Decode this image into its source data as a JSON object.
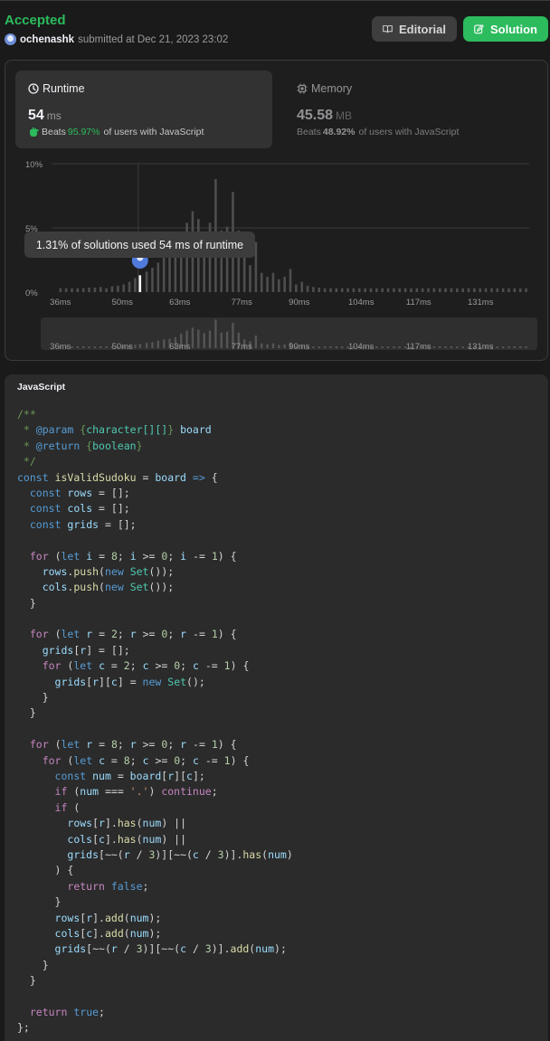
{
  "header": {
    "status": "Accepted",
    "username": "ochenashk",
    "submitted_text": "submitted at Dec 21, 2023 23:02",
    "editorial_label": "Editorial",
    "solution_label": "Solution"
  },
  "runtime": {
    "title": "Runtime",
    "value": "54",
    "unit": "ms",
    "beats_prefix": "Beats",
    "beats_pct": "95.97%",
    "beats_suffix": "of users with JavaScript"
  },
  "memory": {
    "title": "Memory",
    "value": "45.58",
    "unit": "MB",
    "beats_prefix": "Beats",
    "beats_pct": "48.92%",
    "beats_suffix": "of users with JavaScript"
  },
  "tooltip": "1.31% of solutions used 54 ms of runtime",
  "chart_data": {
    "type": "bar",
    "y_ticks": [
      "10%",
      "5%",
      "0%"
    ],
    "ylim": [
      0,
      10
    ],
    "x_ticks": [
      "36ms",
      "50ms",
      "63ms",
      "77ms",
      "90ms",
      "104ms",
      "117ms",
      "131ms"
    ],
    "x_tick_values": [
      36,
      50,
      63,
      77,
      90,
      104,
      117,
      131
    ],
    "xlim": [
      34,
      142
    ],
    "highlight_x": 54,
    "highlight_value": 1.31,
    "bars": [
      {
        "x": 36,
        "v": 0.3
      },
      {
        "x": 37.3,
        "v": 0.3
      },
      {
        "x": 38.6,
        "v": 0.3
      },
      {
        "x": 39.9,
        "v": 0.3
      },
      {
        "x": 41.2,
        "v": 0.3
      },
      {
        "x": 42.5,
        "v": 0.35
      },
      {
        "x": 43.8,
        "v": 0.35
      },
      {
        "x": 45.1,
        "v": 0.4
      },
      {
        "x": 46.4,
        "v": 0.3
      },
      {
        "x": 47.7,
        "v": 0.45
      },
      {
        "x": 49,
        "v": 0.5
      },
      {
        "x": 50.3,
        "v": 0.6
      },
      {
        "x": 51.6,
        "v": 0.8
      },
      {
        "x": 52.9,
        "v": 1.1
      },
      {
        "x": 54,
        "v": 1.31
      },
      {
        "x": 55.5,
        "v": 1.6
      },
      {
        "x": 56.8,
        "v": 1.9
      },
      {
        "x": 58.1,
        "v": 2.3
      },
      {
        "x": 59.4,
        "v": 2.7
      },
      {
        "x": 60.7,
        "v": 2.9
      },
      {
        "x": 62,
        "v": 3.4
      },
      {
        "x": 63.3,
        "v": 4.5
      },
      {
        "x": 64.6,
        "v": 5.4
      },
      {
        "x": 65.9,
        "v": 6.3
      },
      {
        "x": 67.2,
        "v": 5.7
      },
      {
        "x": 68.5,
        "v": 4.6
      },
      {
        "x": 69.8,
        "v": 5.4
      },
      {
        "x": 71.1,
        "v": 8.8
      },
      {
        "x": 72.4,
        "v": 4.8
      },
      {
        "x": 73.7,
        "v": 5.1
      },
      {
        "x": 75,
        "v": 7.8
      },
      {
        "x": 76.3,
        "v": 4.8
      },
      {
        "x": 77.6,
        "v": 2.7
      },
      {
        "x": 78.9,
        "v": 2.1
      },
      {
        "x": 80.2,
        "v": 3.9
      },
      {
        "x": 81.5,
        "v": 1.5
      },
      {
        "x": 82.8,
        "v": 1.2
      },
      {
        "x": 84.1,
        "v": 1.5
      },
      {
        "x": 85.4,
        "v": 1.0
      },
      {
        "x": 86.7,
        "v": 1.2
      },
      {
        "x": 88,
        "v": 1.8
      },
      {
        "x": 89.3,
        "v": 0.6
      },
      {
        "x": 90.6,
        "v": 0.8
      },
      {
        "x": 91.9,
        "v": 0.5
      },
      {
        "x": 93.2,
        "v": 0.4
      },
      {
        "x": 94.5,
        "v": 0.35
      },
      {
        "x": 95.8,
        "v": 0.3
      },
      {
        "x": 97.1,
        "v": 0.3
      },
      {
        "x": 98.4,
        "v": 0.3
      },
      {
        "x": 99.7,
        "v": 0.3
      },
      {
        "x": 101,
        "v": 0.3
      },
      {
        "x": 102.3,
        "v": 0.3
      },
      {
        "x": 103.6,
        "v": 0.3
      },
      {
        "x": 104.9,
        "v": 0.3
      },
      {
        "x": 106.2,
        "v": 0.3
      },
      {
        "x": 107.5,
        "v": 0.3
      },
      {
        "x": 108.8,
        "v": 0.3
      },
      {
        "x": 110.1,
        "v": 0.3
      },
      {
        "x": 111.4,
        "v": 0.3
      },
      {
        "x": 112.7,
        "v": 0.3
      },
      {
        "x": 114,
        "v": 0.3
      },
      {
        "x": 115.3,
        "v": 0.3
      },
      {
        "x": 116.6,
        "v": 0.3
      },
      {
        "x": 117.9,
        "v": 0.3
      },
      {
        "x": 119.2,
        "v": 0.3
      },
      {
        "x": 120.5,
        "v": 0.3
      },
      {
        "x": 121.8,
        "v": 0.3
      },
      {
        "x": 123.1,
        "v": 0.3
      },
      {
        "x": 124.4,
        "v": 0.3
      },
      {
        "x": 125.7,
        "v": 0.3
      },
      {
        "x": 127,
        "v": 0.3
      },
      {
        "x": 128.3,
        "v": 0.3
      },
      {
        "x": 129.6,
        "v": 0.3
      },
      {
        "x": 130.9,
        "v": 0.3
      },
      {
        "x": 132.2,
        "v": 0.3
      },
      {
        "x": 133.5,
        "v": 0.3
      },
      {
        "x": 134.8,
        "v": 0.3
      },
      {
        "x": 136.1,
        "v": 0.3
      },
      {
        "x": 137.4,
        "v": 0.3
      },
      {
        "x": 138.7,
        "v": 0.3
      },
      {
        "x": 140,
        "v": 0.3
      },
      {
        "x": 141.3,
        "v": 0.3
      }
    ],
    "grid": true,
    "legend": "none"
  },
  "code": {
    "language": "JavaScript",
    "lines": [
      [
        [
          "c",
          "/**"
        ]
      ],
      [
        [
          "c",
          " * "
        ],
        [
          "ck",
          "@param"
        ],
        [
          "c",
          " {"
        ],
        [
          "ct",
          "character[][]"
        ],
        [
          "c",
          "} "
        ],
        [
          "v",
          "board"
        ]
      ],
      [
        [
          "c",
          " * "
        ],
        [
          "ck",
          "@return"
        ],
        [
          "c",
          " {"
        ],
        [
          "ct",
          "boolean"
        ],
        [
          "c",
          "}"
        ]
      ],
      [
        [
          "c",
          " */"
        ]
      ],
      [
        [
          "k",
          "const"
        ],
        [
          "t",
          " "
        ],
        [
          "f",
          "isValidSudoku"
        ],
        [
          "t",
          " = "
        ],
        [
          "v",
          "board"
        ],
        [
          "t",
          " "
        ],
        [
          "k",
          "=>"
        ],
        [
          "t",
          " {"
        ]
      ],
      [
        [
          "t",
          "  "
        ],
        [
          "k",
          "const"
        ],
        [
          "t",
          " "
        ],
        [
          "v",
          "rows"
        ],
        [
          "t",
          " = [];"
        ]
      ],
      [
        [
          "t",
          "  "
        ],
        [
          "k",
          "const"
        ],
        [
          "t",
          " "
        ],
        [
          "v",
          "cols"
        ],
        [
          "t",
          " = [];"
        ]
      ],
      [
        [
          "t",
          "  "
        ],
        [
          "k",
          "const"
        ],
        [
          "t",
          " "
        ],
        [
          "v",
          "grids"
        ],
        [
          "t",
          " = [];"
        ]
      ],
      [],
      [
        [
          "t",
          "  "
        ],
        [
          "x",
          "for"
        ],
        [
          "t",
          " ("
        ],
        [
          "k",
          "let"
        ],
        [
          "t",
          " "
        ],
        [
          "v",
          "i"
        ],
        [
          "t",
          " = "
        ],
        [
          "n",
          "8"
        ],
        [
          "t",
          "; "
        ],
        [
          "v",
          "i"
        ],
        [
          "t",
          " >= "
        ],
        [
          "n",
          "0"
        ],
        [
          "t",
          "; "
        ],
        [
          "v",
          "i"
        ],
        [
          "t",
          " -= "
        ],
        [
          "n",
          "1"
        ],
        [
          "t",
          ") {"
        ]
      ],
      [
        [
          "t",
          "    "
        ],
        [
          "v",
          "rows"
        ],
        [
          "t",
          "."
        ],
        [
          "f",
          "push"
        ],
        [
          "t",
          "("
        ],
        [
          "k",
          "new"
        ],
        [
          "t",
          " "
        ],
        [
          "y",
          "Set"
        ],
        [
          "t",
          "());"
        ]
      ],
      [
        [
          "t",
          "    "
        ],
        [
          "v",
          "cols"
        ],
        [
          "t",
          "."
        ],
        [
          "f",
          "push"
        ],
        [
          "t",
          "("
        ],
        [
          "k",
          "new"
        ],
        [
          "t",
          " "
        ],
        [
          "y",
          "Set"
        ],
        [
          "t",
          "());"
        ]
      ],
      [
        [
          "t",
          "  }"
        ]
      ],
      [],
      [
        [
          "t",
          "  "
        ],
        [
          "x",
          "for"
        ],
        [
          "t",
          " ("
        ],
        [
          "k",
          "let"
        ],
        [
          "t",
          " "
        ],
        [
          "v",
          "r"
        ],
        [
          "t",
          " = "
        ],
        [
          "n",
          "2"
        ],
        [
          "t",
          "; "
        ],
        [
          "v",
          "r"
        ],
        [
          "t",
          " >= "
        ],
        [
          "n",
          "0"
        ],
        [
          "t",
          "; "
        ],
        [
          "v",
          "r"
        ],
        [
          "t",
          " -= "
        ],
        [
          "n",
          "1"
        ],
        [
          "t",
          ") {"
        ]
      ],
      [
        [
          "t",
          "    "
        ],
        [
          "v",
          "grids"
        ],
        [
          "t",
          "["
        ],
        [
          "v",
          "r"
        ],
        [
          "t",
          "] = [];"
        ]
      ],
      [
        [
          "t",
          "    "
        ],
        [
          "x",
          "for"
        ],
        [
          "t",
          " ("
        ],
        [
          "k",
          "let"
        ],
        [
          "t",
          " "
        ],
        [
          "v",
          "c"
        ],
        [
          "t",
          " = "
        ],
        [
          "n",
          "2"
        ],
        [
          "t",
          "; "
        ],
        [
          "v",
          "c"
        ],
        [
          "t",
          " >= "
        ],
        [
          "n",
          "0"
        ],
        [
          "t",
          "; "
        ],
        [
          "v",
          "c"
        ],
        [
          "t",
          " -= "
        ],
        [
          "n",
          "1"
        ],
        [
          "t",
          ") {"
        ]
      ],
      [
        [
          "t",
          "      "
        ],
        [
          "v",
          "grids"
        ],
        [
          "t",
          "["
        ],
        [
          "v",
          "r"
        ],
        [
          "t",
          "]["
        ],
        [
          "v",
          "c"
        ],
        [
          "t",
          "] = "
        ],
        [
          "k",
          "new"
        ],
        [
          "t",
          " "
        ],
        [
          "y",
          "Set"
        ],
        [
          "t",
          "();"
        ]
      ],
      [
        [
          "t",
          "    }"
        ]
      ],
      [
        [
          "t",
          "  }"
        ]
      ],
      [],
      [
        [
          "t",
          "  "
        ],
        [
          "x",
          "for"
        ],
        [
          "t",
          " ("
        ],
        [
          "k",
          "let"
        ],
        [
          "t",
          " "
        ],
        [
          "v",
          "r"
        ],
        [
          "t",
          " = "
        ],
        [
          "n",
          "8"
        ],
        [
          "t",
          "; "
        ],
        [
          "v",
          "r"
        ],
        [
          "t",
          " >= "
        ],
        [
          "n",
          "0"
        ],
        [
          "t",
          "; "
        ],
        [
          "v",
          "r"
        ],
        [
          "t",
          " -= "
        ],
        [
          "n",
          "1"
        ],
        [
          "t",
          ") {"
        ]
      ],
      [
        [
          "t",
          "    "
        ],
        [
          "x",
          "for"
        ],
        [
          "t",
          " ("
        ],
        [
          "k",
          "let"
        ],
        [
          "t",
          " "
        ],
        [
          "v",
          "c"
        ],
        [
          "t",
          " = "
        ],
        [
          "n",
          "8"
        ],
        [
          "t",
          "; "
        ],
        [
          "v",
          "c"
        ],
        [
          "t",
          " >= "
        ],
        [
          "n",
          "0"
        ],
        [
          "t",
          "; "
        ],
        [
          "v",
          "c"
        ],
        [
          "t",
          " -= "
        ],
        [
          "n",
          "1"
        ],
        [
          "t",
          ") {"
        ]
      ],
      [
        [
          "t",
          "      "
        ],
        [
          "k",
          "const"
        ],
        [
          "t",
          " "
        ],
        [
          "v",
          "num"
        ],
        [
          "t",
          " = "
        ],
        [
          "v",
          "board"
        ],
        [
          "t",
          "["
        ],
        [
          "v",
          "r"
        ],
        [
          "t",
          "]["
        ],
        [
          "v",
          "c"
        ],
        [
          "t",
          "];"
        ]
      ],
      [
        [
          "t",
          "      "
        ],
        [
          "x",
          "if"
        ],
        [
          "t",
          " ("
        ],
        [
          "v",
          "num"
        ],
        [
          "t",
          " === "
        ],
        [
          "s",
          "'.'"
        ],
        [
          "t",
          ") "
        ],
        [
          "x",
          "continue"
        ],
        [
          "t",
          ";"
        ]
      ],
      [
        [
          "t",
          "      "
        ],
        [
          "x",
          "if"
        ],
        [
          "t",
          " ("
        ]
      ],
      [
        [
          "t",
          "        "
        ],
        [
          "v",
          "rows"
        ],
        [
          "t",
          "["
        ],
        [
          "v",
          "r"
        ],
        [
          "t",
          "]."
        ],
        [
          "f",
          "has"
        ],
        [
          "t",
          "("
        ],
        [
          "v",
          "num"
        ],
        [
          "t",
          ") ||"
        ]
      ],
      [
        [
          "t",
          "        "
        ],
        [
          "v",
          "cols"
        ],
        [
          "t",
          "["
        ],
        [
          "v",
          "c"
        ],
        [
          "t",
          "]."
        ],
        [
          "f",
          "has"
        ],
        [
          "t",
          "("
        ],
        [
          "v",
          "num"
        ],
        [
          "t",
          ") ||"
        ]
      ],
      [
        [
          "t",
          "        "
        ],
        [
          "v",
          "grids"
        ],
        [
          "t",
          "[~~("
        ],
        [
          "v",
          "r"
        ],
        [
          "t",
          " / "
        ],
        [
          "n",
          "3"
        ],
        [
          "t",
          ")][~~("
        ],
        [
          "v",
          "c"
        ],
        [
          "t",
          " / "
        ],
        [
          "n",
          "3"
        ],
        [
          "t",
          ")]."
        ],
        [
          "f",
          "has"
        ],
        [
          "t",
          "("
        ],
        [
          "v",
          "num"
        ],
        [
          "t",
          ")"
        ]
      ],
      [
        [
          "t",
          "      ) {"
        ]
      ],
      [
        [
          "t",
          "        "
        ],
        [
          "x",
          "return"
        ],
        [
          "t",
          " "
        ],
        [
          "k",
          "false"
        ],
        [
          "t",
          ";"
        ]
      ],
      [
        [
          "t",
          "      }"
        ]
      ],
      [
        [
          "t",
          "      "
        ],
        [
          "v",
          "rows"
        ],
        [
          "t",
          "["
        ],
        [
          "v",
          "r"
        ],
        [
          "t",
          "]."
        ],
        [
          "f",
          "add"
        ],
        [
          "t",
          "("
        ],
        [
          "v",
          "num"
        ],
        [
          "t",
          ");"
        ]
      ],
      [
        [
          "t",
          "      "
        ],
        [
          "v",
          "cols"
        ],
        [
          "t",
          "["
        ],
        [
          "v",
          "c"
        ],
        [
          "t",
          "]."
        ],
        [
          "f",
          "add"
        ],
        [
          "t",
          "("
        ],
        [
          "v",
          "num"
        ],
        [
          "t",
          ");"
        ]
      ],
      [
        [
          "t",
          "      "
        ],
        [
          "v",
          "grids"
        ],
        [
          "t",
          "[~~("
        ],
        [
          "v",
          "r"
        ],
        [
          "t",
          " / "
        ],
        [
          "n",
          "3"
        ],
        [
          "t",
          ")][~~("
        ],
        [
          "v",
          "c"
        ],
        [
          "t",
          " / "
        ],
        [
          "n",
          "3"
        ],
        [
          "t",
          ")]."
        ],
        [
          "f",
          "add"
        ],
        [
          "t",
          "("
        ],
        [
          "v",
          "num"
        ],
        [
          "t",
          ");"
        ]
      ],
      [
        [
          "t",
          "    }"
        ]
      ],
      [
        [
          "t",
          "  }"
        ]
      ],
      [],
      [
        [
          "t",
          "  "
        ],
        [
          "x",
          "return"
        ],
        [
          "t",
          " "
        ],
        [
          "k",
          "true"
        ],
        [
          "t",
          ";"
        ]
      ],
      [
        [
          "t",
          "};"
        ]
      ]
    ]
  }
}
